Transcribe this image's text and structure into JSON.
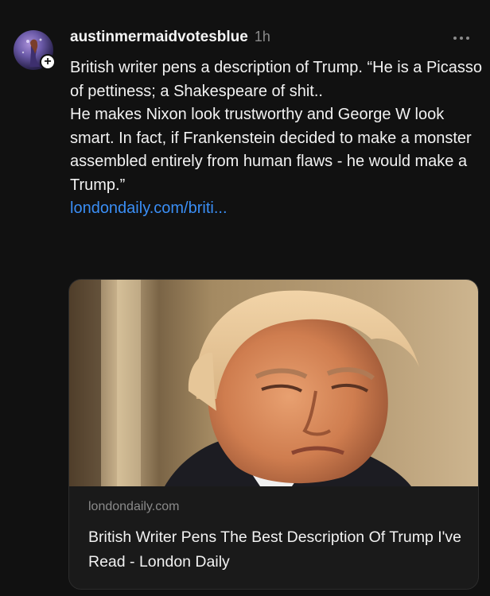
{
  "post": {
    "username": "austinmermaidvotesblue",
    "time": "1h",
    "more_icon": "more-horizontal-icon",
    "follow_icon": "plus-icon",
    "paragraphs": [
      "British writer pens a description of Trump. “He is a Picasso of pettiness; a Shakespeare of shit..",
      "He makes Nixon look trustworthy and George W look smart. In fact, if Frankenstein decided to make a monster assembled entirely from human flaws - he would make a Trump.”"
    ],
    "link_text": "londondaily.com/briti..."
  },
  "link_card": {
    "domain": "londondaily.com",
    "title": "British Writer Pens The Best Description Of Trump I've Read - London Daily"
  },
  "colors": {
    "background": "#111111",
    "text": "#f2f2f2",
    "muted": "#8a8a8a",
    "link": "#3a8ef5"
  }
}
